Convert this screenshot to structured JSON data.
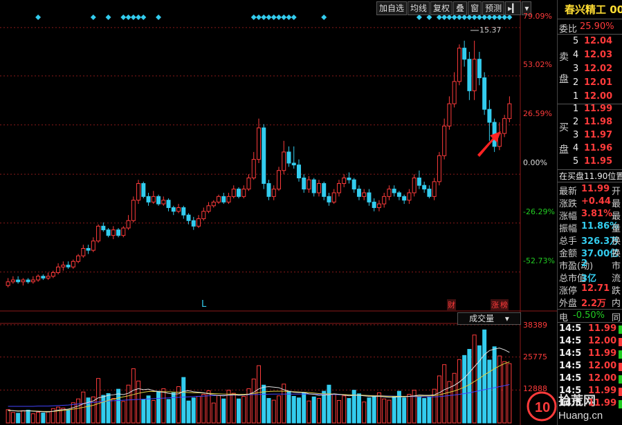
{
  "toolbar": {
    "buttons": [
      "加自选",
      "均线",
      "复权",
      "叠",
      "窗",
      "预测"
    ],
    "arrow": "▸▎",
    "dropdown": "▾"
  },
  "price_axis": {
    "labels": [
      "79.09%",
      "53.02%",
      "26.59%",
      "0.00%",
      "-26.29%",
      "-52.73%"
    ]
  },
  "max_marker": "15.37",
  "bottom_markers": {
    "left": "L",
    "cai": "财",
    "zhang": "涨",
    "bang": "榜"
  },
  "volume": {
    "indicator": "成交量",
    "axis_labels": [
      "38389",
      "25775",
      "12888"
    ]
  },
  "side": {
    "title": "春兴精工 00",
    "weibi_label": "委比",
    "weibi_value": "25.90%",
    "sell_label": [
      "卖",
      "盘"
    ],
    "sell": [
      {
        "level": "5",
        "price": "12.04"
      },
      {
        "level": "4",
        "price": "12.03"
      },
      {
        "level": "3",
        "price": "12.02"
      },
      {
        "level": "2",
        "price": "12.01"
      },
      {
        "level": "1",
        "price": "12.00"
      }
    ],
    "buy_label": [
      "买",
      "盘"
    ],
    "buy": [
      {
        "level": "1",
        "price": "11.99"
      },
      {
        "level": "2",
        "price": "11.98"
      },
      {
        "level": "3",
        "price": "11.97"
      },
      {
        "level": "4",
        "price": "11.96"
      },
      {
        "level": "5",
        "price": "11.95"
      }
    ],
    "position_text": "在买盘11.90位置",
    "stats": [
      {
        "label": "最新",
        "value": "11.99",
        "tail": "开"
      },
      {
        "label": "涨跌",
        "value": "+0.44",
        "tail": "最"
      },
      {
        "label": "涨幅",
        "value": "3.81%",
        "tail": "最"
      },
      {
        "label": "振幅",
        "value": "11.86%",
        "tail": "量"
      },
      {
        "label": "总手",
        "value": "326.3万",
        "tail": "换"
      },
      {
        "label": "金额",
        "value": "37.00亿",
        "tail": "换"
      },
      {
        "label": "市盈(动)",
        "value": "2",
        "tail": "市"
      },
      {
        "label": "总市值",
        "value": "3亿",
        "tail": "流"
      },
      {
        "label": "涨停",
        "value": "12.71",
        "tail": "跌"
      },
      {
        "label": "外盘",
        "value": "2.2万",
        "tail": "内"
      }
    ],
    "sector": "电",
    "sector_change": "-0.50%",
    "sector_tail": "同",
    "ticks": [
      {
        "time": "14:5",
        "price": "11.99"
      },
      {
        "time": "14:5",
        "price": "12.00"
      },
      {
        "time": "14:5",
        "price": "11.99"
      },
      {
        "time": "14:5",
        "price": "12.00"
      },
      {
        "time": "14:5",
        "price": "12.00"
      },
      {
        "time": "14:5",
        "price": "11.99"
      },
      {
        "time": "14:5",
        "price": "11.99"
      }
    ]
  },
  "watermark": {
    "brand": "拾荒网",
    "url": "Huang.cn"
  },
  "colors": {
    "up": "#ff3b3b",
    "down": "#33ccee",
    "grid": "#8b1a1a",
    "ma_white": "#e0e0e0",
    "ma_yellow": "#e0d040",
    "ma_blue": "#4444ff"
  },
  "chart_data": {
    "type": "candlestick",
    "note_ranges": {
      "price_pct_ylim": [
        -70,
        85
      ]
    },
    "candles": [
      [
        -60,
        -58,
        -61,
        -56
      ],
      [
        -58,
        -57,
        -59,
        -55
      ],
      [
        -57,
        -58,
        -59,
        -55
      ],
      [
        -58,
        -57,
        -60,
        -56
      ],
      [
        -57,
        -58,
        -59,
        -56
      ],
      [
        -58,
        -57,
        -59,
        -55
      ],
      [
        -57,
        -55,
        -58,
        -54
      ],
      [
        -55,
        -56,
        -57,
        -54
      ],
      [
        -56,
        -55,
        -57,
        -53
      ],
      [
        -55,
        -53,
        -56,
        -52
      ],
      [
        -53,
        -50,
        -54,
        -48
      ],
      [
        -50,
        -49,
        -52,
        -47
      ],
      [
        -49,
        -50,
        -51,
        -47
      ],
      [
        -50,
        -47,
        -51,
        -46
      ],
      [
        -47,
        -44,
        -48,
        -43
      ],
      [
        -44,
        -40,
        -45,
        -38
      ],
      [
        -40,
        -41,
        -43,
        -38
      ],
      [
        -41,
        -36,
        -42,
        -34
      ],
      [
        -36,
        -28,
        -37,
        -27
      ],
      [
        -28,
        -30,
        -31,
        -26
      ],
      [
        -30,
        -33,
        -34,
        -29
      ],
      [
        -33,
        -30,
        -35,
        -28
      ],
      [
        -30,
        -33,
        -34,
        -29
      ],
      [
        -33,
        -29,
        -34,
        -28
      ],
      [
        -29,
        -25,
        -30,
        -22
      ],
      [
        -25,
        -14,
        -26,
        -12
      ],
      [
        -14,
        -5,
        -16,
        -3
      ],
      [
        -5,
        -12,
        -13,
        -4
      ],
      [
        -12,
        -15,
        -17,
        -10
      ],
      [
        -15,
        -12,
        -16,
        -9
      ],
      [
        -12,
        -16,
        -17,
        -11
      ],
      [
        -16,
        -14,
        -17,
        -12
      ],
      [
        -14,
        -18,
        -20,
        -13
      ],
      [
        -18,
        -20,
        -22,
        -17
      ],
      [
        -20,
        -18,
        -21,
        -16
      ],
      [
        -18,
        -22,
        -24,
        -17
      ],
      [
        -22,
        -25,
        -27,
        -21
      ],
      [
        -25,
        -28,
        -30,
        -23
      ],
      [
        -28,
        -24,
        -29,
        -22
      ],
      [
        -24,
        -20,
        -25,
        -18
      ],
      [
        -20,
        -17,
        -21,
        -15
      ],
      [
        -17,
        -15,
        -18,
        -14
      ],
      [
        -15,
        -12,
        -16,
        -11
      ],
      [
        -12,
        -15,
        -16,
        -10
      ],
      [
        -15,
        -12,
        -16,
        -10
      ],
      [
        -12,
        -8,
        -13,
        -6
      ],
      [
        -8,
        -12,
        -13,
        -7
      ],
      [
        -12,
        -8,
        -13,
        -6
      ],
      [
        -8,
        -2,
        -9,
        0
      ],
      [
        -2,
        8,
        -3,
        12
      ],
      [
        8,
        25,
        6,
        30
      ],
      [
        25,
        -5,
        -8,
        27
      ],
      [
        -5,
        -12,
        -14,
        -3
      ],
      [
        -12,
        -8,
        -14,
        -6
      ],
      [
        -8,
        2,
        -9,
        4
      ],
      [
        2,
        12,
        0,
        18
      ],
      [
        12,
        6,
        4,
        15
      ],
      [
        6,
        5,
        3,
        15
      ],
      [
        5,
        -2,
        -4,
        8
      ],
      [
        -2,
        -8,
        -10,
        0
      ],
      [
        -8,
        -3,
        -10,
        -1
      ],
      [
        -3,
        -10,
        -12,
        -2
      ],
      [
        -10,
        -5,
        -12,
        -3
      ],
      [
        -5,
        -12,
        -14,
        -4
      ],
      [
        -12,
        -15,
        -17,
        -10
      ],
      [
        -15,
        -10,
        -16,
        -8
      ],
      [
        -10,
        -5,
        -12,
        -3
      ],
      [
        -5,
        -2,
        -7,
        0
      ],
      [
        -2,
        -3,
        -5,
        1
      ],
      [
        -3,
        -8,
        -10,
        -2
      ],
      [
        -8,
        -12,
        -14,
        -6
      ],
      [
        -12,
        -10,
        -14,
        -8
      ],
      [
        -10,
        -15,
        -17,
        -8
      ],
      [
        -15,
        -18,
        -20,
        -13
      ],
      [
        -18,
        -16,
        -20,
        -14
      ],
      [
        -16,
        -12,
        -18,
        -10
      ],
      [
        -12,
        -8,
        -14,
        -6
      ],
      [
        -8,
        -10,
        -12,
        -6
      ],
      [
        -10,
        -12,
        -14,
        -9
      ],
      [
        -12,
        -14,
        -16,
        -11
      ],
      [
        -14,
        -10,
        -16,
        -8
      ],
      [
        -10,
        -2,
        -12,
        0
      ],
      [
        -2,
        -6,
        -8,
        2
      ],
      [
        -6,
        -8,
        -10,
        -4
      ],
      [
        -8,
        -12,
        -13,
        -6
      ],
      [
        -12,
        -4,
        -14,
        -2
      ],
      [
        -4,
        10,
        -6,
        12
      ],
      [
        10,
        26,
        8,
        30
      ],
      [
        26,
        38,
        24,
        42
      ],
      [
        38,
        50,
        36,
        55
      ],
      [
        50,
        68,
        48,
        70
      ],
      [
        68,
        62,
        58,
        72
      ],
      [
        62,
        45,
        40,
        66
      ],
      [
        45,
        62,
        40,
        72
      ],
      [
        62,
        52,
        48,
        66
      ],
      [
        52,
        35,
        32,
        55
      ],
      [
        35,
        28,
        18,
        40
      ],
      [
        28,
        15,
        12,
        30
      ],
      [
        15,
        22,
        13,
        28
      ],
      [
        22,
        30,
        20,
        32
      ],
      [
        30,
        38,
        28,
        42
      ]
    ],
    "volume": [
      5200,
      4100,
      3800,
      4800,
      5000,
      3600,
      4200,
      3900,
      4400,
      5600,
      6200,
      5800,
      5100,
      7900,
      9400,
      12100,
      9800,
      10200,
      17400,
      10800,
      11500,
      9600,
      13200,
      8400,
      14800,
      21200,
      16400,
      9100,
      10600,
      8800,
      12400,
      13400,
      9200,
      11800,
      14200,
      17800,
      8600,
      9800,
      10400,
      11200,
      12600,
      7800,
      10800,
      9400,
      12800,
      11600,
      9400,
      10400,
      13400,
      17200,
      22400,
      14800,
      9600,
      8900,
      10600,
      15200,
      12400,
      10400,
      9800,
      11800,
      8600,
      10200,
      9600,
      12400,
      14800,
      11200,
      8800,
      10600,
      9600,
      12800,
      11400,
      8200,
      9800,
      10400,
      11800,
      9400,
      8900,
      10200,
      12400,
      9800,
      11200,
      12800,
      10400,
      9600,
      10200,
      13200,
      18400,
      22800,
      16200,
      19400,
      24800,
      26400,
      28800,
      34400,
      30200,
      36400,
      24600,
      29800,
      26200,
      24000,
      23200
    ],
    "ma_volume_white": [
      5000,
      4800,
      4600,
      4700,
      4800,
      4600,
      4500,
      4400,
      4300,
      4600,
      5000,
      5200,
      5400,
      6000,
      6600,
      7500,
      8000,
      8600,
      9800,
      10200,
      10800,
      11000,
      11400,
      11100,
      11600,
      12800,
      13400,
      13000,
      13200,
      12600,
      12200,
      12000,
      11600,
      11300,
      11400,
      12400,
      12600,
      12200,
      12000,
      11800,
      11400,
      11000,
      10700,
      10600,
      10900,
      11000,
      10800,
      10900,
      11200,
      12000,
      13300,
      14000,
      14200,
      14000,
      13800,
      13000,
      12400,
      12000,
      11900,
      11900,
      11400,
      11200,
      10800,
      10900,
      11000,
      11400,
      11200,
      10900,
      10600,
      10800,
      10800,
      10600,
      10400,
      10300,
      10400,
      10200,
      10000,
      10000,
      10300,
      10200,
      10400,
      10600,
      10900,
      10800,
      10800,
      11000,
      11800,
      13000,
      13800,
      14700,
      16000,
      17600,
      19700,
      22000,
      24200,
      26700,
      28300,
      28900,
      29300,
      28600,
      27600
    ],
    "ma_volume_yellow": [
      4800,
      4800,
      4700,
      4700,
      4700,
      4700,
      4600,
      4500,
      4500,
      4500,
      4700,
      4900,
      5100,
      5400,
      5700,
      6100,
      6500,
      6900,
      7600,
      8200,
      8800,
      9300,
      9800,
      10200,
      10600,
      11100,
      11600,
      12000,
      12300,
      12300,
      12300,
      12200,
      12200,
      12100,
      12000,
      12000,
      11900,
      11800,
      11800,
      11700,
      11600,
      11500,
      11400,
      11300,
      11300,
      11300,
      11200,
      11200,
      11300,
      11500,
      11900,
      12200,
      12300,
      12400,
      12400,
      12400,
      12300,
      12200,
      12100,
      12000,
      11900,
      11700,
      11500,
      11400,
      11400,
      11300,
      11200,
      11100,
      11000,
      10900,
      10900,
      10800,
      10700,
      10600,
      10600,
      10500,
      10400,
      10400,
      10400,
      10400,
      10400,
      10500,
      10500,
      10600,
      10600,
      10700,
      11000,
      11500,
      12000,
      12500,
      13200,
      14000,
      15000,
      16200,
      17400,
      18800,
      20000,
      21200,
      22300,
      23200,
      23900
    ],
    "ma_volume_blue": [
      6500,
      6500,
      6500,
      6500,
      6500,
      6500,
      6600,
      6600,
      6600,
      6700,
      6800,
      6900,
      7000,
      7200,
      7400,
      7600,
      7800,
      8000,
      8200,
      8400,
      8600,
      8700,
      8800,
      8900,
      9000,
      9100,
      9200,
      9300,
      9400,
      9500,
      9600,
      9700,
      9800,
      9900,
      10000,
      10100,
      10200,
      10300,
      10400,
      10500,
      10600,
      10700,
      10750,
      10800,
      10850,
      10900,
      10950,
      11000,
      11050,
      11100,
      11150,
      11200,
      11250,
      11300,
      11300,
      11300,
      11300,
      11300,
      11300,
      11300,
      11300,
      11300,
      11250,
      11200,
      11150,
      11100,
      11050,
      11000,
      10950,
      10900,
      10850,
      10800,
      10750,
      10700,
      10650,
      10600,
      10550,
      10500,
      10450,
      10400,
      10350,
      10300,
      10250,
      10200,
      10200,
      10200,
      10300,
      10500,
      10700,
      10900,
      11200,
      11500,
      11800,
      12200,
      12600,
      13000,
      13400,
      13800,
      14200,
      14600,
      15000
    ],
    "volume_ylim": [
      0,
      38389
    ]
  }
}
